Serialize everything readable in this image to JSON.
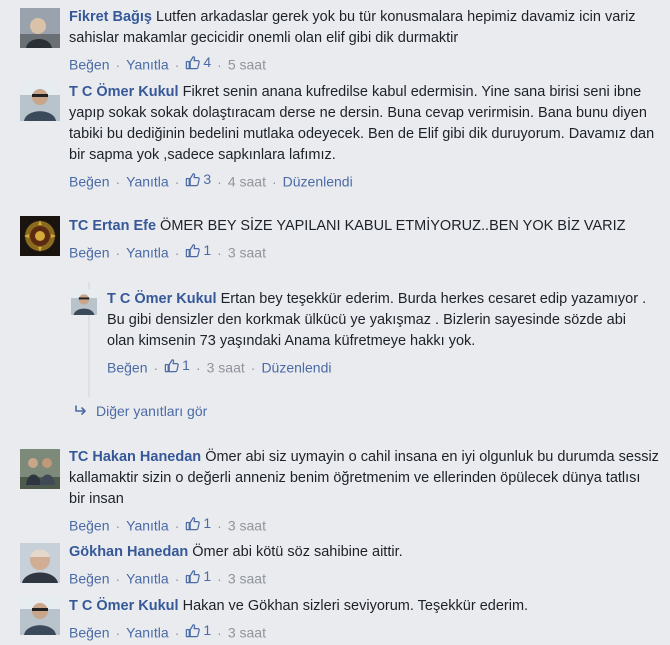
{
  "actions": {
    "like": "Beğen",
    "reply": "Yanıtla",
    "separator": "·",
    "edited": "Düzenlendi"
  },
  "comments": [
    {
      "author": "Fikret Bağış",
      "text": "Lutfen arkadaslar gerek yok bu tür konusmalara hepimiz davamiz icin variz sahislar makamlar gecicidir onemli olan elif gibi dik durmaktir",
      "likes": "4",
      "time": "5 saat"
    },
    {
      "author": "T C Ömer Kukul",
      "text": "Fikret senin anana kufredilse kabul edermisin. Yine sana birisi seni ibne yapıp sokak sokak dolaştıracam derse ne dersin. Buna cevap verirmisin. Bana bunu diyen tabiki bu dediğinin bedelini mutlaka odeyecek. Ben de Elif gibi dik duruyorum. Davamız dan bir sapma yok ,sadece sapkınlara lafımız.",
      "likes": "3",
      "time": "4 saat"
    },
    {
      "author": "TC Ertan Efe",
      "text": "ÖMER BEY SİZE YAPILANI KABUL ETMİYORUZ..BEN YOK BİZ VARIZ",
      "likes": "1",
      "time": "3 saat"
    },
    {
      "author": "T C Ömer Kukul",
      "text": "Ertan bey teşekkür ederim. Burda herkes cesaret edip yazamıyor . Bu gibi densizler den korkmak ülkücü ye yakışmaz . Bizlerin sayesinde sözde abi olan kimsenin 73 yaşındaki Anama küfretmeye hakkı yok.",
      "likes": "1",
      "time": "3 saat"
    },
    {
      "author": "TC Hakan Hanedan",
      "text": "Ömer abi siz uymayin o cahil insana en iyi olgunluk bu durumda sessiz kallamaktir sizin o değerli anneniz benim öğretmenim ve ellerinden öpülecek dünya tatlısı bir insan",
      "likes": "1",
      "time": "3 saat"
    },
    {
      "author": "Gökhan Hanedan",
      "text": "Ömer abi kötü söz sahibine aittir.",
      "likes": "1",
      "time": "3 saat"
    },
    {
      "author": "T C Ömer Kukul",
      "text": "Hakan ve Gökhan sizleri seviyorum. Teşekkür ederim.",
      "likes": "1",
      "time": "3 saat"
    }
  ],
  "more_replies": "Diğer yanıtları gör",
  "colors": {
    "author": "#365899",
    "link": "#4b6aa6",
    "meta": "#90949c",
    "text": "#1d2129",
    "background": "#e9ebee"
  },
  "icons": {
    "like": "thumbs-up-icon",
    "reply_arrow": "reply-arrow-icon"
  }
}
